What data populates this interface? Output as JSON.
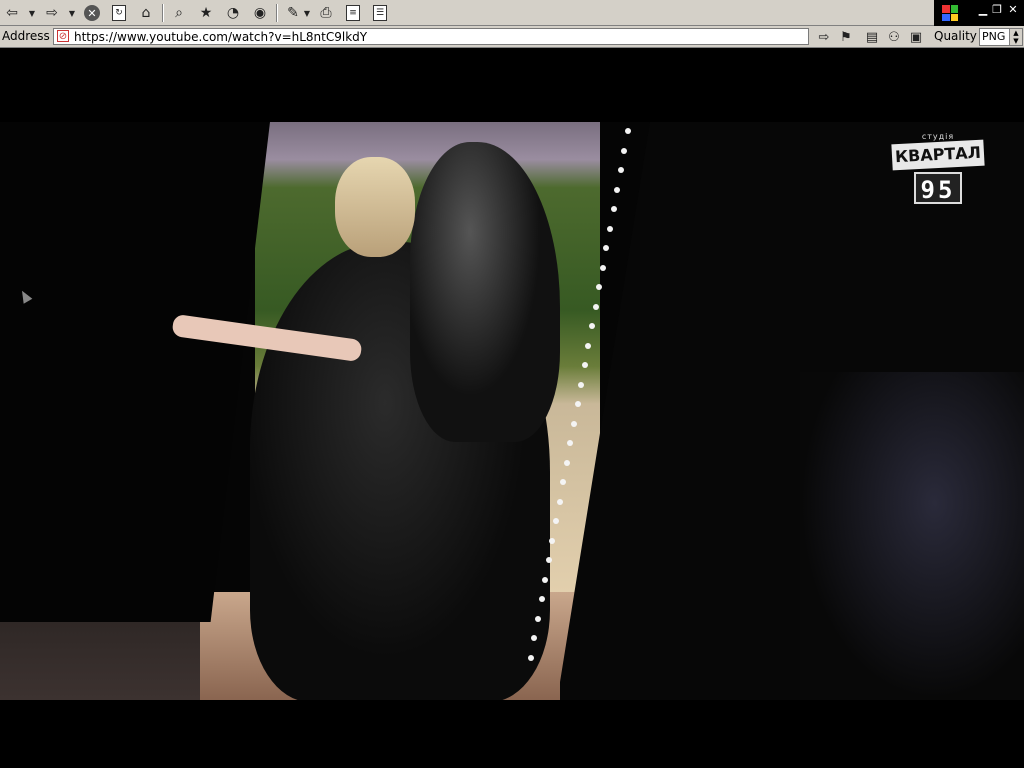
{
  "toolbar": {
    "buttons": [
      {
        "name": "back",
        "icon": "back-arrow-icon"
      },
      {
        "name": "forward",
        "icon": "forward-arrow-icon"
      },
      {
        "name": "stop",
        "icon": "stop-icon"
      },
      {
        "name": "refresh",
        "icon": "refresh-icon"
      },
      {
        "name": "home",
        "icon": "home-icon"
      },
      {
        "name": "search",
        "icon": "search-icon"
      },
      {
        "name": "favorites",
        "icon": "favorites-icon"
      },
      {
        "name": "history",
        "icon": "history-icon"
      },
      {
        "name": "media",
        "icon": "media-icon"
      },
      {
        "name": "edit",
        "icon": "edit-icon"
      },
      {
        "name": "print",
        "icon": "print-icon"
      },
      {
        "name": "discuss",
        "icon": "discuss-icon"
      },
      {
        "name": "page",
        "icon": "page-icon"
      }
    ]
  },
  "address_bar": {
    "label": "Address",
    "url": "https://www.youtube.com/watch?v=hL8ntC9lkdY",
    "quality_label": "Quality",
    "format_value": "PNG"
  },
  "video": {
    "logo_top": "студія",
    "logo_main": "КВАРТАЛ",
    "logo_number": "95"
  }
}
